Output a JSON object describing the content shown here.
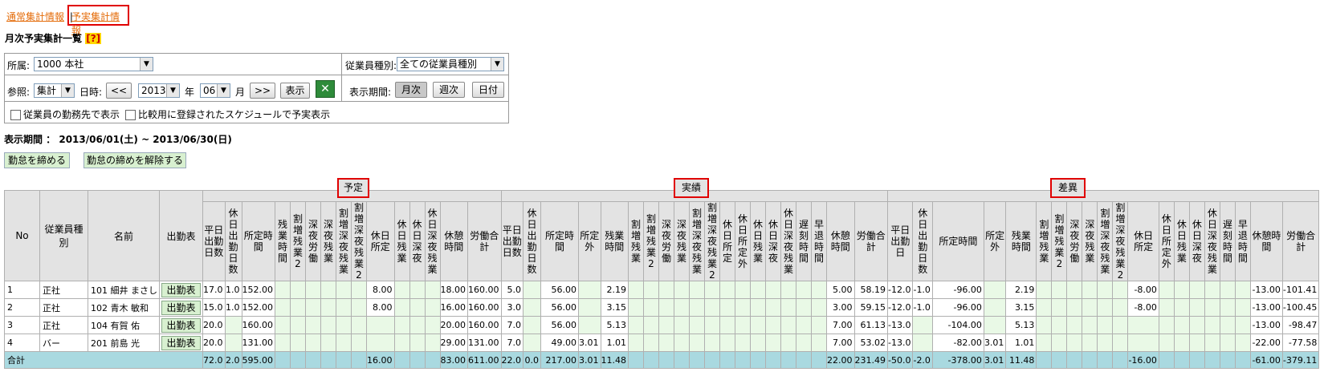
{
  "top_links": {
    "normal": "通常集計情報",
    "separator": "|",
    "plan": "予実集計情報"
  },
  "page_title": "月次予実集計一覧",
  "help": "[?]",
  "filters": {
    "affiliation_label": "所属:",
    "affiliation_value": "1000 本社",
    "emp_type_label": "従業員種別:",
    "emp_type_value": "全ての従業員種別",
    "ref_label": "参照:",
    "ref_value": "集計",
    "date_label": "日時:",
    "prev": "<<",
    "year": "2013",
    "year_unit": "年",
    "month": "06",
    "month_unit": "月",
    "next": ">>",
    "show": "表示",
    "period_label": "表示期間:",
    "monthly": "月次",
    "weekly": "週次",
    "daily": "日付",
    "chk1": "従業員の勤務先で表示",
    "chk2": "比較用に登録されたスケジュールで予実表示"
  },
  "display_period": "表示期間 ： 2013/06/01(土) ~ 2013/06/30(日)",
  "actions": {
    "close": "勤怠を締める",
    "unclose": "勤怠の締めを解除する"
  },
  "groups": {
    "plan": "予定",
    "actual": "実績",
    "diff": "差異"
  },
  "headers": {
    "fixed": [
      "No",
      "従業員種別",
      "名前",
      "出勤表"
    ],
    "plan": [
      "平日出勤日数",
      "休日出勤日数",
      "所定時間",
      "残業時間",
      "割増残業2",
      "深夜労働",
      "深夜残業",
      "割増深夜残業",
      "割増深夜残業2",
      "休日所定",
      "休日残業",
      "休日深夜",
      "休日深夜残業",
      "休憩時間",
      "労働合計"
    ],
    "actual": [
      "平日出勤日数",
      "休日出勤日数",
      "所定時間",
      "所定外",
      "残業時間",
      "割増残業",
      "割増残業2",
      "深夜労働",
      "深夜残業",
      "割増深夜残業",
      "割増深夜残業2",
      "休日所定",
      "休日所定外",
      "休日残業",
      "休日深夜",
      "休日深夜残業",
      "遅刻時間",
      "早退時間",
      "休憩時間",
      "労働合計"
    ],
    "diff": [
      "平日出勤日",
      "休日出勤日数",
      "所定時間",
      "所定外",
      "残業時間",
      "割増残業",
      "割増残業2",
      "深夜労働",
      "深夜残業",
      "割増深夜残業",
      "割増深夜残業2",
      "休日所定",
      "休日所定外",
      "休日残業",
      "休日深夜",
      "休日深夜残業",
      "遅刻時間",
      "早退時間",
      "休憩時間",
      "労働合計"
    ]
  },
  "rows": [
    {
      "no": "1",
      "type": "正社",
      "name": "101 細井 まさし",
      "btn": "出勤表",
      "plan": [
        "17.0",
        "1.0",
        "152.00",
        "",
        "",
        "",
        "",
        "",
        "",
        "8.00",
        "",
        "",
        "",
        "18.00",
        "160.00"
      ],
      "actual": [
        "5.0",
        "",
        "56.00",
        "",
        "2.19",
        "",
        "",
        "",
        "",
        "",
        "",
        "",
        "",
        "",
        "",
        "",
        "",
        "",
        "5.00",
        "58.19"
      ],
      "diff": [
        "-12.0",
        "-1.0",
        "-96.00",
        "",
        "2.19",
        "",
        "",
        "",
        "",
        "",
        "",
        "-8.00",
        "",
        "",
        "",
        "",
        "",
        "",
        "-13.00",
        "-101.41"
      ]
    },
    {
      "no": "2",
      "type": "正社",
      "name": "102 青木 敏和",
      "btn": "出勤表",
      "plan": [
        "15.0",
        "1.0",
        "152.00",
        "",
        "",
        "",
        "",
        "",
        "",
        "8.00",
        "",
        "",
        "",
        "16.00",
        "160.00"
      ],
      "actual": [
        "3.0",
        "",
        "56.00",
        "",
        "3.15",
        "",
        "",
        "",
        "",
        "",
        "",
        "",
        "",
        "",
        "",
        "",
        "",
        "",
        "3.00",
        "59.15"
      ],
      "diff": [
        "-12.0",
        "-1.0",
        "-96.00",
        "",
        "3.15",
        "",
        "",
        "",
        "",
        "",
        "",
        "-8.00",
        "",
        "",
        "",
        "",
        "",
        "",
        "-13.00",
        "-100.45"
      ]
    },
    {
      "no": "3",
      "type": "正社",
      "name": "104 有賀 佑",
      "btn": "出勤表",
      "plan": [
        "20.0",
        "",
        "160.00",
        "",
        "",
        "",
        "",
        "",
        "",
        "",
        "",
        "",
        "",
        "20.00",
        "160.00"
      ],
      "actual": [
        "7.0",
        "",
        "56.00",
        "",
        "5.13",
        "",
        "",
        "",
        "",
        "",
        "",
        "",
        "",
        "",
        "",
        "",
        "",
        "",
        "7.00",
        "61.13"
      ],
      "diff": [
        "-13.0",
        "",
        "-104.00",
        "",
        "5.13",
        "",
        "",
        "",
        "",
        "",
        "",
        "",
        "",
        "",
        "",
        "",
        "",
        "",
        "-13.00",
        "-98.47"
      ]
    },
    {
      "no": "4",
      "type": "バー",
      "name": "201 前島 光",
      "btn": "出勤表",
      "plan": [
        "20.0",
        "",
        "131.00",
        "",
        "",
        "",
        "",
        "",
        "",
        "",
        "",
        "",
        "",
        "29.00",
        "131.00"
      ],
      "actual": [
        "7.0",
        "",
        "49.00",
        "3.01",
        "1.01",
        "",
        "",
        "",
        "",
        "",
        "",
        "",
        "",
        "",
        "",
        "",
        "",
        "",
        "7.00",
        "53.02"
      ],
      "diff": [
        "-13.0",
        "",
        "-82.00",
        "3.01",
        "1.01",
        "",
        "",
        "",
        "",
        "",
        "",
        "",
        "",
        "",
        "",
        "",
        "",
        "",
        "-22.00",
        "-77.58"
      ]
    }
  ],
  "total": {
    "label": "合計",
    "plan": [
      "72.0",
      "2.0",
      "595.00",
      "",
      "",
      "",
      "",
      "",
      "",
      "16.00",
      "",
      "",
      "",
      "83.00",
      "611.00"
    ],
    "actual": [
      "22.0",
      "0.0",
      "217.00",
      "3.01",
      "11.48",
      "",
      "",
      "",
      "",
      "",
      "",
      "",
      "",
      "",
      "",
      "",
      "",
      "",
      "22.00",
      "231.49"
    ],
    "diff": [
      "-50.0",
      "-2.0",
      "-378.00",
      "3.01",
      "11.48",
      "",
      "",
      "",
      "",
      "",
      "",
      "-16.00",
      "",
      "",
      "",
      "",
      "",
      "",
      "-61.00",
      "-379.11"
    ]
  }
}
